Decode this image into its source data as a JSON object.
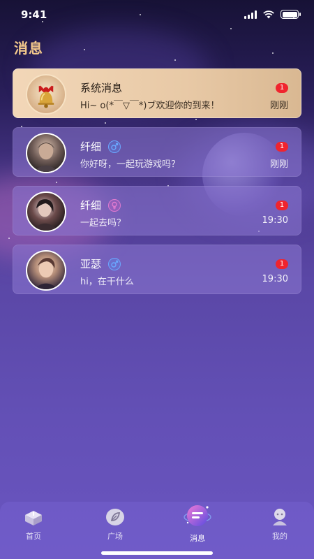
{
  "status_bar": {
    "time": "9:41"
  },
  "header": {
    "title": "消息"
  },
  "messages": [
    {
      "name": "系统消息",
      "preview": "Hi~ o(*￣▽￣*)ブ欢迎你的到来！",
      "time": "刚刚",
      "unread": "1",
      "avatar_icon": "bell-icon"
    },
    {
      "name": "纤细",
      "preview": "你好呀，一起玩游戏吗？",
      "time": "刚刚",
      "unread": "1",
      "gender_icon": "male-icon"
    },
    {
      "name": "纤细",
      "preview": "一起去吗？",
      "time": "19:30",
      "unread": "1",
      "gender_icon": "female-icon"
    },
    {
      "name": "亚瑟",
      "preview": "hi，在干什么",
      "time": "19:30",
      "unread": "1",
      "gender_icon": "male-icon"
    }
  ],
  "tabs": [
    {
      "label": "首页",
      "icon": "home-box-icon"
    },
    {
      "label": "广场",
      "icon": "plaza-leaf-icon"
    },
    {
      "label": "消息",
      "icon": "message-chat-icon",
      "active": true
    },
    {
      "label": "我的",
      "icon": "profile-icon"
    }
  ],
  "colors": {
    "title": "#f4c98c",
    "badge": "#f0242e",
    "male": "#6aa8ff",
    "female": "#e07ad0"
  }
}
